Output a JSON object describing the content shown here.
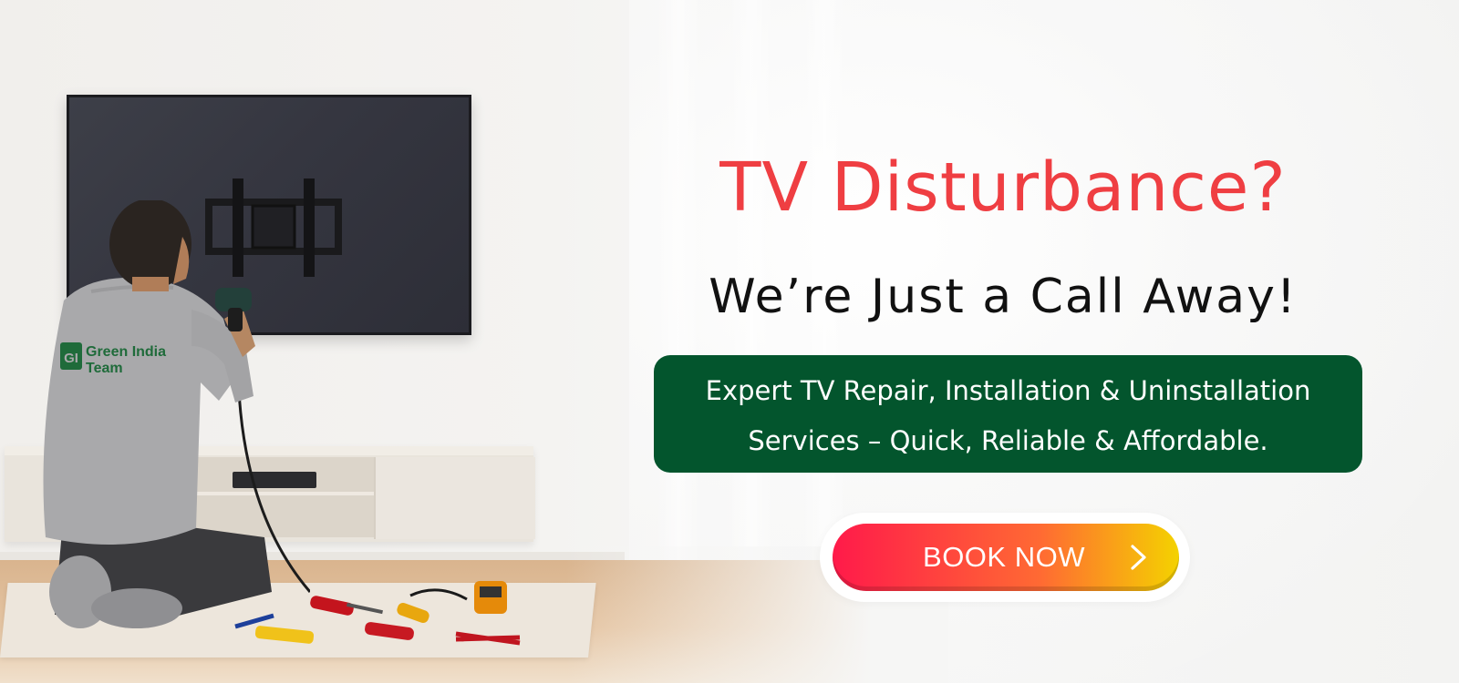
{
  "banner": {
    "headline": "TV Disturbance?",
    "subheadline": "We’re Just a Call Away!",
    "services": {
      "line1": "Expert TV Repair, Installation & Uninstallation",
      "line2": "Services – Quick, Reliable & Affordable."
    },
    "cta": {
      "label": "BOOK NOW",
      "icon": "chevron-right-icon"
    }
  },
  "photo": {
    "shirt_logo": {
      "monogram": "GI",
      "line1": "Green India",
      "line2": "Team"
    }
  },
  "colors": {
    "headline": "#ef3e42",
    "subheadline": "#111111",
    "services_bg": "#03552d",
    "services_text": "#ffffff",
    "cta_gradient_start": "#ff1a4a",
    "cta_gradient_mid": "#ff6a33",
    "cta_gradient_end": "#f4d200",
    "brand_green": "#1f6b3a"
  }
}
